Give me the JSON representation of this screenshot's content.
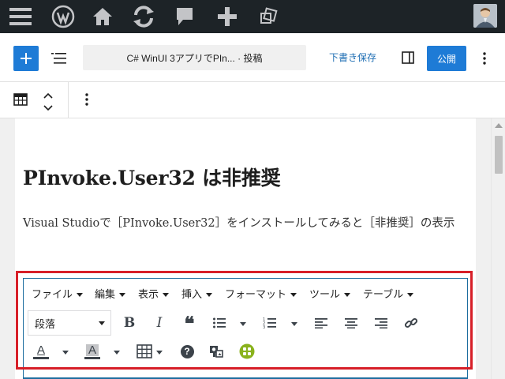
{
  "colors": {
    "admin_bar_bg": "#1d2327",
    "accent": "#1e7bd6",
    "highlight_border": "#d71f28",
    "editor_border": "#1d6d9f"
  },
  "admin_bar": {
    "icons": [
      "menu-icon",
      "wordpress-logo-icon",
      "home-icon",
      "updates-icon",
      "comments-icon",
      "new-content-icon",
      "duplicate-icon",
      "user-avatar"
    ]
  },
  "editor_header": {
    "post_title": "C# WinUI 3アプリでPIn... · 投稿",
    "save_draft": "下書き保存",
    "publish": "公開",
    "icons": [
      "add-block-icon",
      "list-view-icon",
      "sidebar-toggle-icon",
      "more-options-icon"
    ]
  },
  "block_toolbar": {
    "icons": [
      "table-block-icon",
      "move-up-icon",
      "move-down-icon",
      "block-options-icon"
    ]
  },
  "content": {
    "heading": "PInvoke.User32 は非推奨",
    "paragraph": "Visual Studioで［PInvoke.User32］をインストールしてみると［非推奨］の表示"
  },
  "classic_editor": {
    "menus": [
      "ファイル",
      "編集",
      "表示",
      "挿入",
      "フォーマット",
      "ツール",
      "テーブル"
    ],
    "format_select": "段落",
    "row1_buttons": {
      "bold": "B",
      "italic": "I",
      "quote": "❝"
    },
    "text_color_letter": "A",
    "bg_color_letter": "A",
    "help_glyph": "?"
  }
}
